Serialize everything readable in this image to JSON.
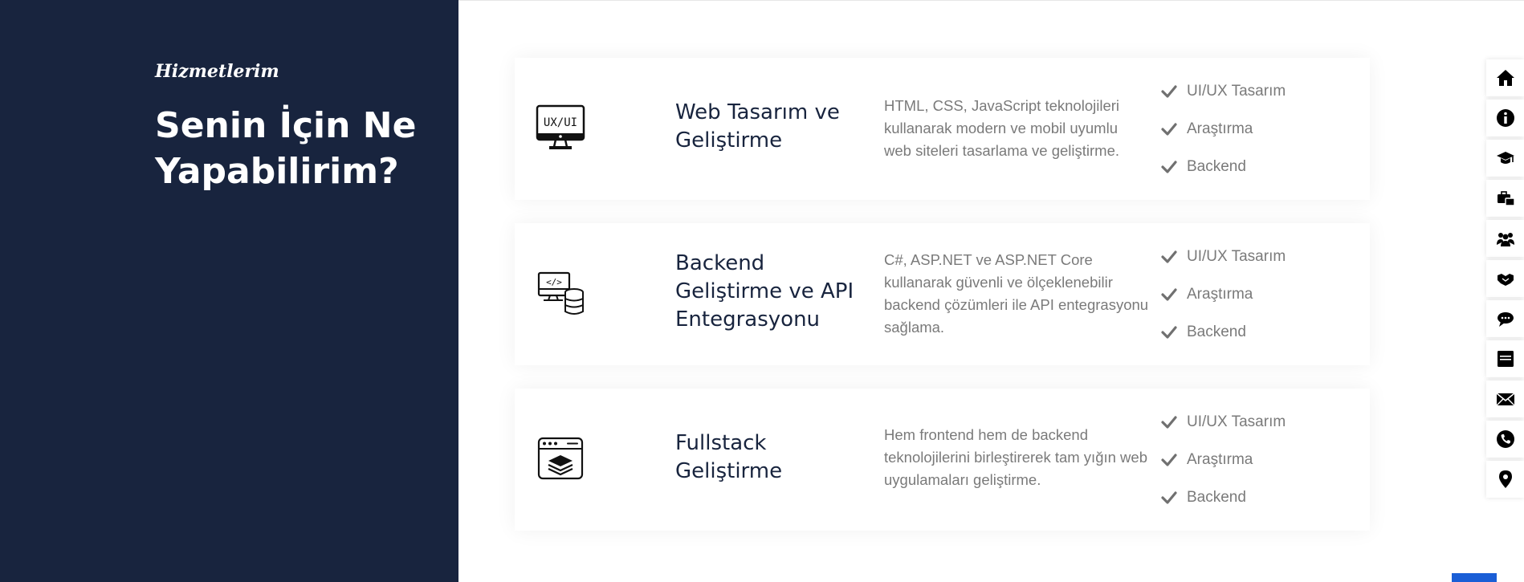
{
  "section": {
    "subtitle": "Hizmetlerim",
    "title": "Senin İçin Ne Yapabilirim?"
  },
  "colors": {
    "panel_background": "#18243e",
    "text_muted": "#7a7a7a",
    "heading_text": "#18243e",
    "accent": "#1a5ed6"
  },
  "services": [
    {
      "icon": "ux-ui-monitor-icon",
      "title": "Web Tasarım ve Geliştirme",
      "description": "HTML, CSS, JavaScript teknolojileri kullanarak modern ve mobil uyumlu web siteleri tasarlama ve geliştirme.",
      "features": [
        "UI/UX Tasarım",
        "Araştırma",
        "Backend"
      ]
    },
    {
      "icon": "code-database-icon",
      "title": "Backend Geliştirme ve API Entegrasyonu",
      "description": "C#, ASP.NET ve ASP.NET Core kullanarak güvenli ve ölçeklenebilir backend çözümleri ile API entegrasyonu sağlama.",
      "features": [
        "UI/UX Tasarım",
        "Araştırma",
        "Backend"
      ]
    },
    {
      "icon": "browser-stack-icon",
      "title": "Fullstack Geliştirme",
      "description": "Hem frontend hem de backend teknolojilerini birleştirerek tam yığın web uygulamaları geliştirme.",
      "features": [
        "UI/UX Tasarım",
        "Araştırma",
        "Backend"
      ]
    }
  ],
  "side_nav": [
    "home-icon",
    "info-icon",
    "graduation-cap-icon",
    "briefcase-icon",
    "team-icon",
    "handshake-icon",
    "chat-icon",
    "blog-icon",
    "envelope-icon",
    "phone-icon",
    "map-pin-icon"
  ]
}
